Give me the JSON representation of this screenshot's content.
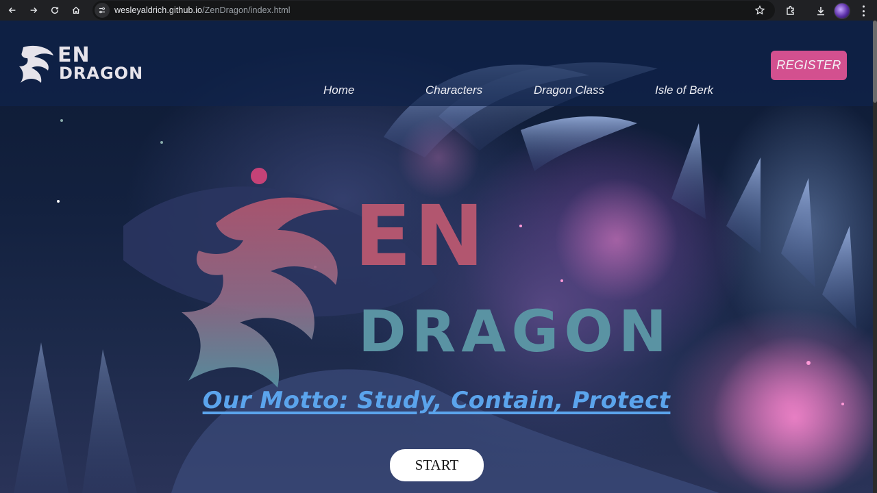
{
  "browser": {
    "url_host": "wesleyaldrich.github.io",
    "url_path": "/ZenDragon/index.html",
    "icons": [
      "back-icon",
      "forward-icon",
      "reload-icon",
      "home-icon",
      "site-info-icon",
      "bookmark-star-icon",
      "extensions-icon",
      "download-icon",
      "profile-avatar",
      "menu-kebab-icon"
    ]
  },
  "header": {
    "logo_line1": "EN",
    "logo_line2": "DRAGON",
    "menu": [
      "Home",
      "Characters",
      "Dragon Class",
      "Isle of Berk"
    ],
    "register_label": "REGISTER"
  },
  "hero": {
    "logo_line1": "EN",
    "logo_line2": "DRAGON",
    "motto": "Our Motto: Study, Contain, Protect",
    "start_label": "START"
  },
  "colors": {
    "register_bg": "#d3508f",
    "motto": "#5ba4ec",
    "hero_top": "#b2566f",
    "hero_bottom": "#5a93a3"
  }
}
